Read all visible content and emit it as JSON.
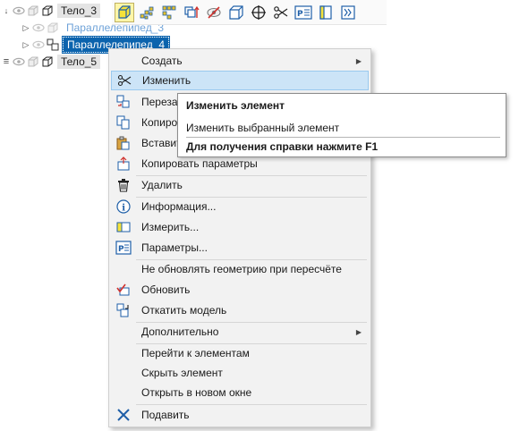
{
  "tree": {
    "items": [
      {
        "label": "Тело_3"
      },
      {
        "label": "Параллелепипед_3"
      },
      {
        "label": "Параллелепипед_4"
      },
      {
        "label": "Тело_5"
      }
    ]
  },
  "toolbar": {
    "buttons": [
      "cube-select-icon",
      "array-points-icon",
      "array-points-alt-icon",
      "rotate-array-icon",
      "hide-icon",
      "box-icon",
      "crosshair-icon",
      "scissors-icon",
      "parameters-icon",
      "bar-icon",
      "expand-icon"
    ]
  },
  "context_menu": {
    "items": [
      {
        "label": "Создать",
        "icon": "none",
        "submenu": true
      },
      {
        "label": "Изменить",
        "icon": "scissors-icon"
      },
      {
        "label": "Переза",
        "icon": "redefine-icon"
      },
      {
        "label": "Копиро",
        "icon": "copy-icon"
      },
      {
        "label": "Вставит",
        "icon": "paste-icon"
      },
      {
        "label": "Копировать параметры",
        "icon": "copy-params-icon"
      },
      {
        "label": "Удалить",
        "icon": "trash-icon"
      },
      {
        "label": "Информация...",
        "icon": "info-icon"
      },
      {
        "label": "Измерить...",
        "icon": "measure-icon"
      },
      {
        "label": "Параметры...",
        "icon": "parameters-icon"
      },
      {
        "label": "Не обновлять геометрию при пересчёте",
        "icon": "none"
      },
      {
        "label": "Обновить",
        "icon": "update-icon"
      },
      {
        "label": "Откатить модель",
        "icon": "rollback-icon"
      },
      {
        "label": "Дополнительно",
        "icon": "none",
        "submenu": true
      },
      {
        "label": "Перейти к элементам",
        "icon": "none"
      },
      {
        "label": "Скрыть элемент",
        "icon": "none"
      },
      {
        "label": "Открыть в новом окне",
        "icon": "none"
      },
      {
        "label": "Подавить",
        "icon": "suppress-icon"
      }
    ],
    "submenu_arrow": "▶"
  },
  "tooltip": {
    "title": "Изменить элемент",
    "line": "Изменить выбранный элемент",
    "help": "Для получения справки нажмите F1"
  },
  "colors": {
    "selection": "#0b63ad",
    "hover": "#cce4f7",
    "menu_bg": "#f2f2f2",
    "accent_red": "#d0312d",
    "icon_blue": "#1f5fa8"
  }
}
